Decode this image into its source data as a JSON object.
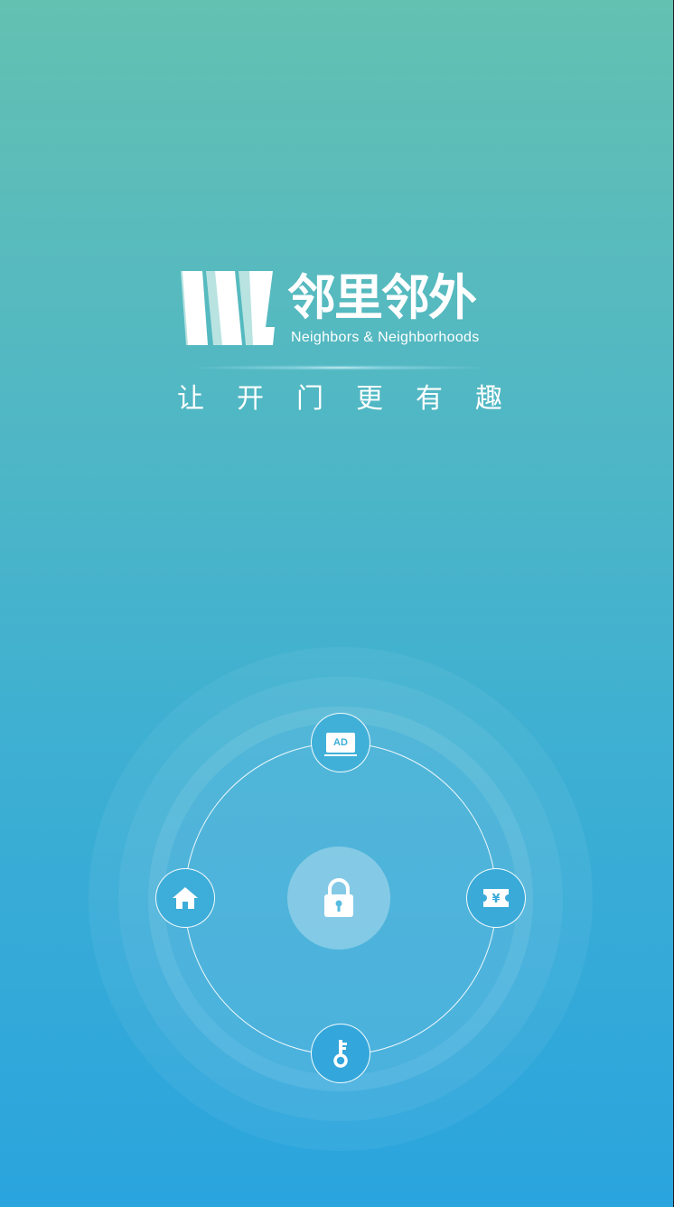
{
  "brand": {
    "name_cn": "邻里邻外",
    "name_en": "Neighbors & Neighborhoods"
  },
  "slogan": "让开门更有趣",
  "dial": {
    "center": {
      "icon": "lock-icon"
    },
    "top": {
      "icon": "ad-icon",
      "label": "AD"
    },
    "left": {
      "icon": "home-icon"
    },
    "right": {
      "icon": "coupon-yen-icon",
      "label": "¥"
    },
    "bottom": {
      "icon": "key-icon"
    }
  },
  "colors": {
    "gradient_top": "#63c1b2",
    "gradient_bottom": "#2aa4de",
    "accent": "#3aaed9"
  }
}
